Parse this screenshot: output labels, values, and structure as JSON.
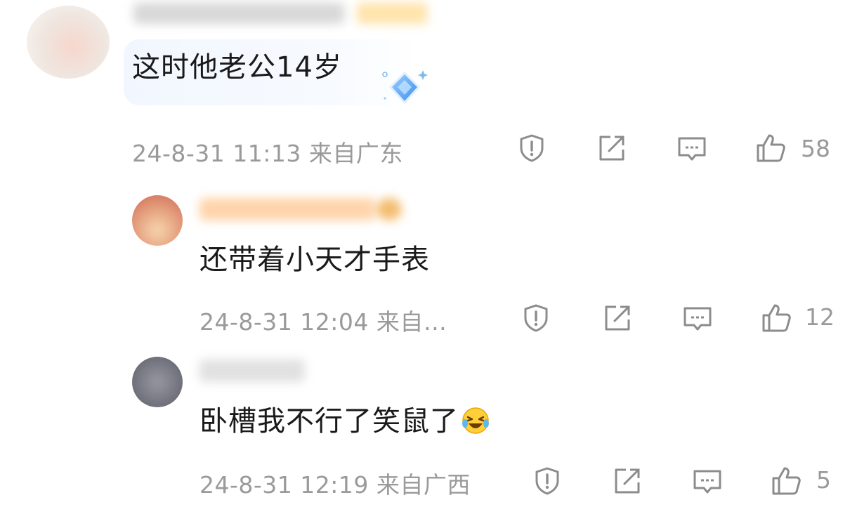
{
  "comments": [
    {
      "text": "这时他老公14岁",
      "time": "24-8-31 11:13",
      "location": "来自广东",
      "likes": "58"
    },
    {
      "text": "还带着小天才手表",
      "time": "24-8-31 12:04",
      "location": "来自…",
      "likes": "12"
    },
    {
      "text": "卧槽我不行了笑鼠了",
      "time": "24-8-31 12:19",
      "location": "来自广西",
      "likes": "5",
      "emoji": "laughing-crying-emoji"
    }
  ],
  "icons": {
    "report": "shield-exclamation-icon",
    "share": "share-arrow-icon",
    "reply": "comment-bubble-icon",
    "like": "thumbs-up-icon"
  },
  "colors": {
    "meta_text": "#9a9a9a",
    "icon_stroke": "#8c8c8c",
    "bubble_bg": "#f2f7ff",
    "name_blur_orange": "#ffb066",
    "name_blur_gray": "#c8c8c8"
  }
}
